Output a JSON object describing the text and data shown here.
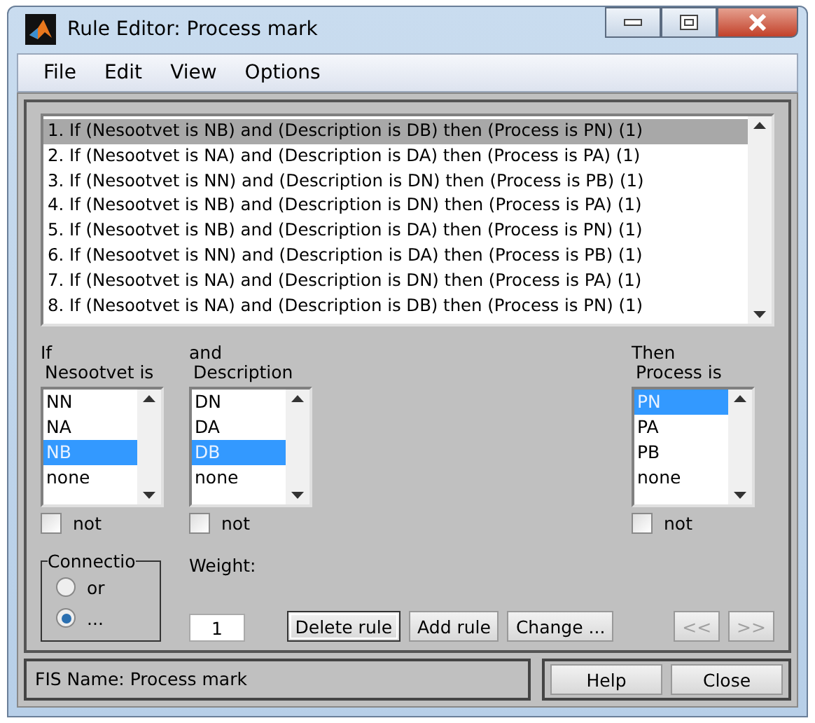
{
  "window": {
    "title": "Rule Editor: Process mark"
  },
  "menu": [
    "File",
    "Edit",
    "View",
    "Options"
  ],
  "rules": [
    {
      "text": "1. If (Nesootvet is NB) and (Description is DB) then (Process is PN) (1)",
      "selected": true
    },
    {
      "text": "2. If (Nesootvet is NA) and (Description is DA) then (Process is PA) (1)",
      "selected": false
    },
    {
      "text": "3. If (Nesootvet is NN) and (Description is DN) then (Process is PB) (1)",
      "selected": false
    },
    {
      "text": "4. If (Nesootvet is NB) and (Description is DN) then (Process is PA) (1)",
      "selected": false
    },
    {
      "text": "5. If (Nesootvet is NB) and (Description is DA) then (Process is PN) (1)",
      "selected": false
    },
    {
      "text": "6. If (Nesootvet is NN) and (Description is DA) then (Process is PB) (1)",
      "selected": false
    },
    {
      "text": "7. If (Nesootvet is NA) and (Description is DN) then (Process is PA) (1)",
      "selected": false
    },
    {
      "text": "8. If (Nesootvet is NA) and (Description is DB) then (Process is PN) (1)",
      "selected": false
    }
  ],
  "variables": [
    {
      "kind": "input",
      "caption": "If",
      "name": "Nesootvet is",
      "options": [
        {
          "label": "NN",
          "selected": false
        },
        {
          "label": "NA",
          "selected": false
        },
        {
          "label": "NB",
          "selected": true
        },
        {
          "label": "none",
          "selected": false
        }
      ],
      "not_label": "not",
      "not_checked": false
    },
    {
      "kind": "input",
      "caption": "and",
      "name": "Description",
      "options": [
        {
          "label": "DN",
          "selected": false
        },
        {
          "label": "DA",
          "selected": false
        },
        {
          "label": "DB",
          "selected": true
        },
        {
          "label": "none",
          "selected": false
        }
      ],
      "not_label": "not",
      "not_checked": false
    },
    {
      "kind": "output",
      "caption": "Then",
      "name": "Process is",
      "options": [
        {
          "label": "PN",
          "selected": true
        },
        {
          "label": "PA",
          "selected": false
        },
        {
          "label": "PB",
          "selected": false
        },
        {
          "label": "none",
          "selected": false
        }
      ],
      "not_label": "not",
      "not_checked": false
    }
  ],
  "connection": {
    "title": "Connectio",
    "options": [
      {
        "label": "or",
        "selected": false
      },
      {
        "label": "...",
        "selected": true
      }
    ]
  },
  "weight": {
    "label": "Weight:",
    "value": "1"
  },
  "actions": [
    {
      "label": "Delete rule",
      "focused": true
    },
    {
      "label": "Add rule",
      "focused": false
    },
    {
      "label": "Change ...",
      "focused": false
    }
  ],
  "nav": [
    {
      "label": "<<",
      "disabled": true
    },
    {
      "label": ">>",
      "disabled": true
    }
  ],
  "status": "FIS Name: Process mark",
  "footer_buttons": [
    "Help",
    "Close"
  ]
}
